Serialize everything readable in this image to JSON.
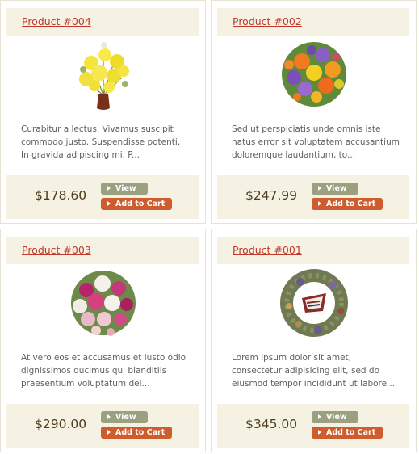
{
  "products": [
    {
      "name": "Product #004",
      "description": "Curabitur a lectus. Vivamus suscipit commodo justo. Suspendisse potenti. In gravida adipiscing mi. P...",
      "price": "$178.60",
      "image": "yellow-daisy-vase-image",
      "view_label": "View",
      "cart_label": "Add to Cart"
    },
    {
      "name": "Product #002",
      "description": "Sed ut perspiciatis unde omnis iste natus error sit voluptatem accusantium doloremque laudantium, to...",
      "price": "$247.99",
      "image": "mixed-bouquet-image",
      "view_label": "View",
      "cart_label": "Add to Cart"
    },
    {
      "name": "Product #003",
      "description": "At vero eos et accusamus et iusto odio dignissimos ducimus qui blanditiis praesentium voluptatum del...",
      "price": "$290.00",
      "image": "pink-white-bouquet-image",
      "view_label": "View",
      "cart_label": "Add to Cart"
    },
    {
      "name": "Product #001",
      "description": "Lorem ipsum dolor sit amet, consectetur adipisicing elit, sed do eiusmod tempor incididunt ut labore...",
      "price": "$345.00",
      "image": "wreath-image",
      "view_label": "View",
      "cart_label": "Add to Cart"
    }
  ],
  "colors": {
    "panel": "#f5f1e3",
    "link": "#c0392b",
    "view_button": "#9aa080",
    "cart_button": "#cf5c2c"
  }
}
